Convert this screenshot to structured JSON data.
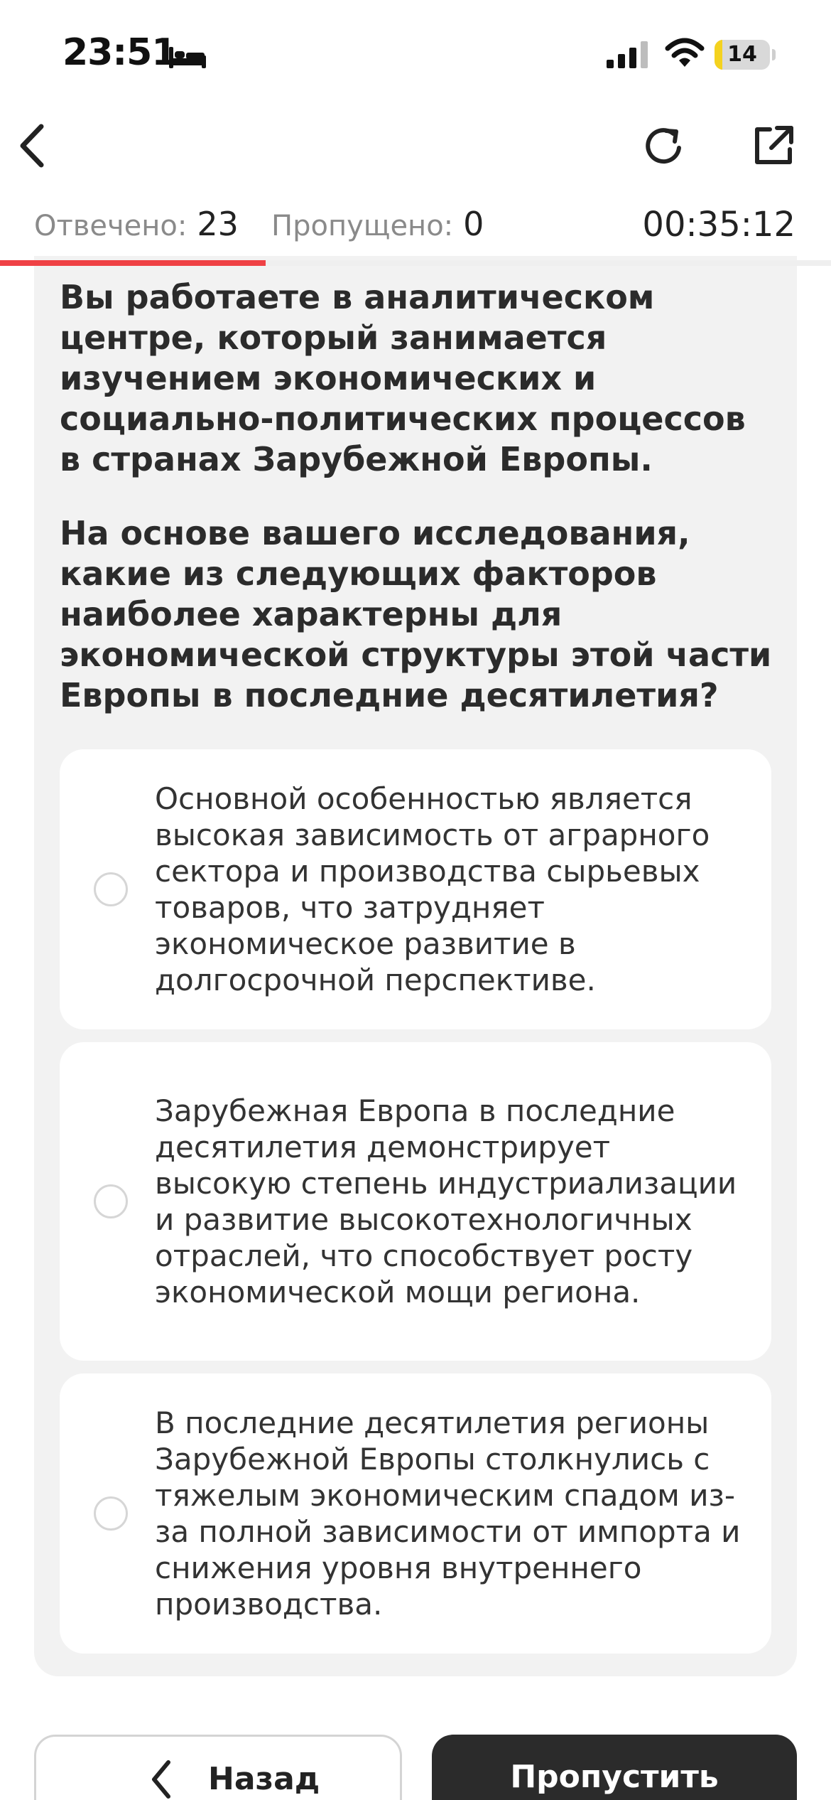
{
  "status_bar": {
    "time": "23:51",
    "battery_level": "14",
    "battery_fraction": 0.14
  },
  "nav": {
    "back_icon": "chevron-left-icon",
    "reload_icon": "reload-icon",
    "share_icon": "external-link-icon"
  },
  "stats": {
    "answered_label": "Отвечено:",
    "answered_value": "23",
    "skipped_label": "Пропущено:",
    "skipped_value": "0",
    "timer": "00:35:12",
    "progress_fraction": 0.32,
    "accent_color": "#ef4145"
  },
  "question": {
    "intro": "Вы работаете в аналитическом центре, который занимается изучением экономических и социально-политических процессов в странах Зарубежной Европы.",
    "prompt": "На основе вашего исследования, какие из следующих факторов наиболее характерны для экономической структуры этой части Европы в последние десятилетия?",
    "options": [
      {
        "text": "Основной особенностью является высокая зависимость от аграрного сектора и производства сырьевых товаров, что затрудняет экономическое развитие в долгосрочной перспективе.",
        "selected": false
      },
      {
        "text": "Зарубежная Европа в последние десятилетия демонстрирует высокую степень индустриализации и развитие высокотехнологичных отраслей, что способствует росту экономической мощи региона.",
        "selected": false
      },
      {
        "text": "В последние десятилетия регионы Зарубежной Европы столкнулись с тяжелым экономическим спадом из-за полной зависимости от импорта и снижения уровня внутреннего производства.",
        "selected": false
      }
    ]
  },
  "buttons": {
    "back_label": "Назад",
    "skip_label": "Пропустить"
  }
}
